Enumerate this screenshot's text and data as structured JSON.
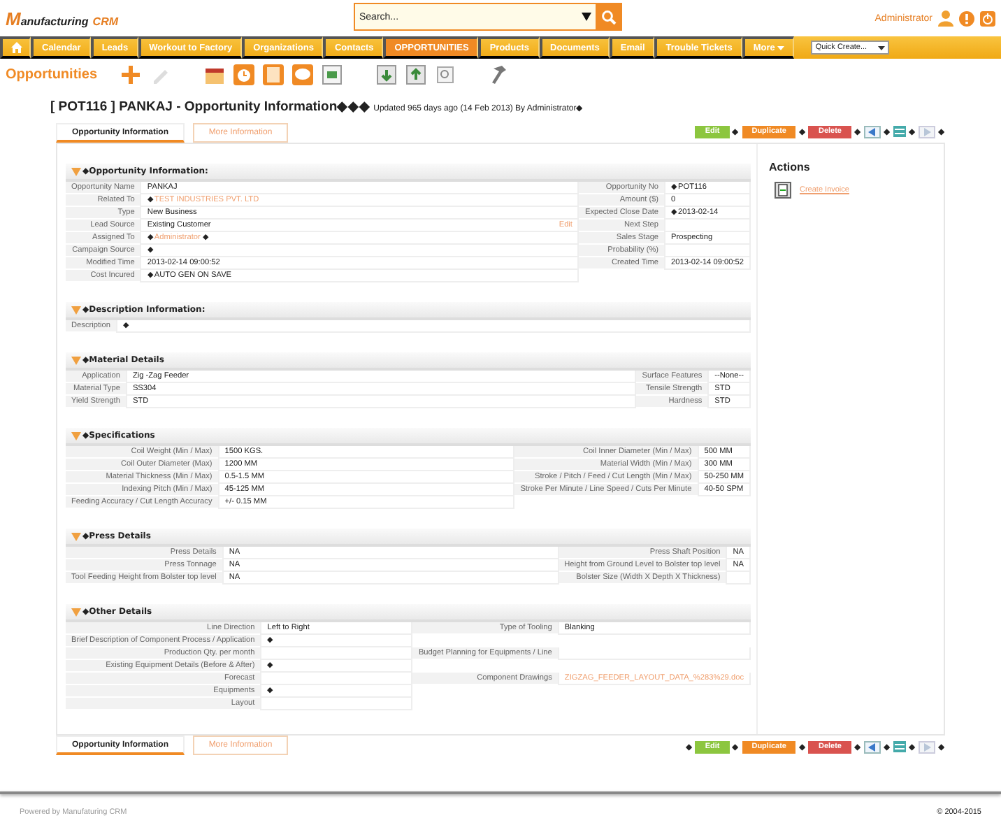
{
  "logo": {
    "initial": "M",
    "rest": "anufacturing",
    "suffix": "CRM"
  },
  "search": {
    "placeholder": "Search..."
  },
  "user": {
    "name": "Administrator"
  },
  "nav": [
    {
      "kind": "home",
      "selected": false
    },
    {
      "label": "Calendar",
      "selected": false
    },
    {
      "label": "Leads",
      "selected": false
    },
    {
      "label": "Workout to Factory",
      "selected": false
    },
    {
      "label": "Organizations",
      "selected": false
    },
    {
      "label": "Contacts",
      "selected": false
    },
    {
      "label": "OPPORTUNITIES",
      "selected": true
    },
    {
      "label": "Products",
      "selected": false
    },
    {
      "label": "Documents",
      "selected": false
    },
    {
      "label": "Email",
      "selected": false
    },
    {
      "label": "Trouble Tickets",
      "selected": false
    },
    {
      "label": "More",
      "kind": "menu",
      "selected": false
    }
  ],
  "quick_create": {
    "value": "Quick Create..."
  },
  "module": {
    "title": "Opportunities"
  },
  "record": {
    "title": "[ POT116 ] PANKAJ - Opportunity Information◆◆◆",
    "updated": "Updated 965 days ago (14 Feb 2013) By Administrator◆"
  },
  "tabs": [
    {
      "label": "Opportunity Information",
      "selected": true
    },
    {
      "label": "More Information",
      "selected": false
    }
  ],
  "bottom_tabs": [
    {
      "label": "Opportunity Information",
      "selected": true
    },
    {
      "label": "More Information",
      "selected": false
    }
  ],
  "actions_top": [
    {
      "kind": "button",
      "label": "Edit",
      "color": "#8cc63f"
    },
    {
      "kind": "sep",
      "label": "◆"
    },
    {
      "kind": "button",
      "label": "Duplicate",
      "color": "#f08a24"
    },
    {
      "kind": "sep",
      "label": "◆"
    },
    {
      "kind": "button",
      "label": "Delete",
      "color": "#d9534f"
    },
    {
      "kind": "sep",
      "label": "◆"
    },
    {
      "kind": "prev"
    },
    {
      "kind": "sep",
      "label": "◆"
    },
    {
      "kind": "list"
    },
    {
      "kind": "sep",
      "label": "◆"
    },
    {
      "kind": "next"
    },
    {
      "kind": "sep",
      "label": "◆"
    }
  ],
  "actions_bottom": [
    {
      "kind": "sep",
      "label": "◆"
    },
    {
      "kind": "button",
      "label": "Edit",
      "color": "#8cc63f"
    },
    {
      "kind": "sep",
      "label": "◆"
    },
    {
      "kind": "button",
      "label": "Duplicate",
      "color": "#f08a24"
    },
    {
      "kind": "sep",
      "label": "◆"
    },
    {
      "kind": "button",
      "label": "Delete",
      "color": "#d9534f"
    },
    {
      "kind": "sep",
      "label": "◆"
    },
    {
      "kind": "prev"
    },
    {
      "kind": "sep",
      "label": "◆"
    },
    {
      "kind": "list"
    },
    {
      "kind": "sep",
      "label": "◆"
    },
    {
      "kind": "next"
    },
    {
      "kind": "sep",
      "label": "◆"
    }
  ],
  "sections": [
    {
      "title": "◆Opportunity Information:",
      "rows": [
        {
          "left": {
            "label": "Opportunity Name",
            "value": "PANKAJ"
          },
          "right": {
            "label": "Opportunity No",
            "value": "◆POT116"
          }
        },
        {
          "left": {
            "label": "Related To",
            "value": "◆",
            "link": "TEST INDUSTRIES PVT. LTD"
          },
          "right": {
            "label": "Amount ($)",
            "value": "0"
          }
        },
        {
          "left": {
            "label": "Type",
            "value": "New Business"
          },
          "right": {
            "label": "Expected Close Date",
            "value": "◆2013-02-14"
          }
        },
        {
          "left": {
            "label": "Lead Source",
            "value": "Existing Customer",
            "action": "Edit"
          },
          "right": {
            "label": "Next Step"
          }
        },
        {
          "left": {
            "label": "Assigned To",
            "value": "◆",
            "link": "Administrator",
            "suffix": "◆"
          },
          "right": {
            "label": "Sales Stage",
            "value": "Prospecting"
          }
        },
        {
          "left": {
            "label": "Campaign Source",
            "value": "◆"
          },
          "right": {
            "label": "Probability (%)"
          }
        },
        {
          "left": {
            "label": "Modified Time",
            "value": "2013-02-14 09:00:52"
          },
          "right": {
            "label": "Created Time",
            "value": "2013-02-14 09:00:52"
          }
        },
        {
          "left": {
            "label": "Cost Incured",
            "value": "◆AUTO GEN ON SAVE"
          }
        }
      ]
    },
    {
      "title": "◆Description Information:",
      "rows": [
        {
          "left": {
            "label": "Description",
            "value": "◆"
          }
        }
      ]
    },
    {
      "title": "◆Material Details",
      "rows": [
        {
          "left": {
            "label": "Application",
            "value": "Zig -Zag Feeder"
          },
          "right": {
            "label": "Surface Features",
            "value": "--None--"
          }
        },
        {
          "left": {
            "label": "Material Type",
            "value": "SS304"
          },
          "right": {
            "label": "Tensile Strength",
            "value": "STD"
          }
        },
        {
          "left": {
            "label": "Yield Strength",
            "value": "STD"
          },
          "right": {
            "label": "Hardness",
            "value": "STD"
          }
        }
      ]
    },
    {
      "title": "◆Specifications",
      "rows": [
        {
          "left": {
            "label": "Coil Weight (Min / Max)",
            "value": "1500 KGS."
          },
          "right": {
            "label": "Coil Inner Diameter (Min / Max)",
            "value": "500 MM"
          }
        },
        {
          "left": {
            "label": "Coil Outer Diameter (Max)",
            "value": "1200 MM"
          },
          "right": {
            "label": "Material Width (Min / Max)",
            "value": "300 MM"
          }
        },
        {
          "left": {
            "label": "Material Thickness (Min / Max)",
            "value": "0.5-1.5 MM"
          },
          "right": {
            "label": "Stroke / Pitch / Feed / Cut Length (Min / Max)",
            "value": "50-250 MM"
          }
        },
        {
          "left": {
            "label": "Indexing Pitch (Min / Max)",
            "value": "45-125 MM"
          },
          "right": {
            "label": "Stroke Per Minute / Line Speed / Cuts Per Minute",
            "value": "40-50 SPM"
          }
        },
        {
          "left": {
            "label": "Feeding Accuracy / Cut Length Accuracy",
            "value": "+/- 0.15 MM"
          }
        }
      ]
    },
    {
      "title": "◆Press Details",
      "rows": [
        {
          "left": {
            "label": "Press Details",
            "value": "NA"
          },
          "right": {
            "label": "Press Shaft Position",
            "value": "NA"
          }
        },
        {
          "left": {
            "label": "Press Tonnage",
            "value": "NA"
          },
          "right": {
            "label": "Height from Ground Level to Bolster top level",
            "value": "NA"
          }
        },
        {
          "left": {
            "label": "Tool Feeding Height from Bolster top level",
            "value": "NA"
          },
          "right": {
            "label": "Bolster Size (Width X Depth X Thickness)"
          }
        }
      ]
    },
    {
      "title": "◆Other Details",
      "rows": [
        {
          "left": {
            "label": "Line Direction",
            "value": "Left to Right"
          },
          "right": {
            "label": "Type of Tooling",
            "value": "Blanking"
          }
        },
        {
          "left": {
            "label": "Brief Description of Component Process / Application",
            "value": "◆"
          }
        },
        {
          "left": {
            "label": "Production Qty. per month"
          },
          "right": {
            "label": "Budget Planning for Equipments / Line"
          }
        },
        {
          "left": {
            "label": "Existing Equipment Details (Before & After)",
            "value": "◆"
          }
        },
        {
          "left": {
            "label": "Forecast"
          },
          "right": {
            "label": "Component Drawings",
            "link": "ZIGZAG_FEEDER_LAYOUT_DATA_%283%29.doc"
          }
        },
        {
          "left": {
            "label": "Equipments",
            "value": "◆"
          }
        },
        {
          "left": {
            "label": "Layout"
          }
        }
      ]
    }
  ],
  "side": {
    "title": "Actions",
    "items": [
      {
        "label": "Create Invoice"
      }
    ]
  },
  "footer": {
    "left": "Powered by Manufaturing CRM",
    "right": "© 2004-2015"
  }
}
